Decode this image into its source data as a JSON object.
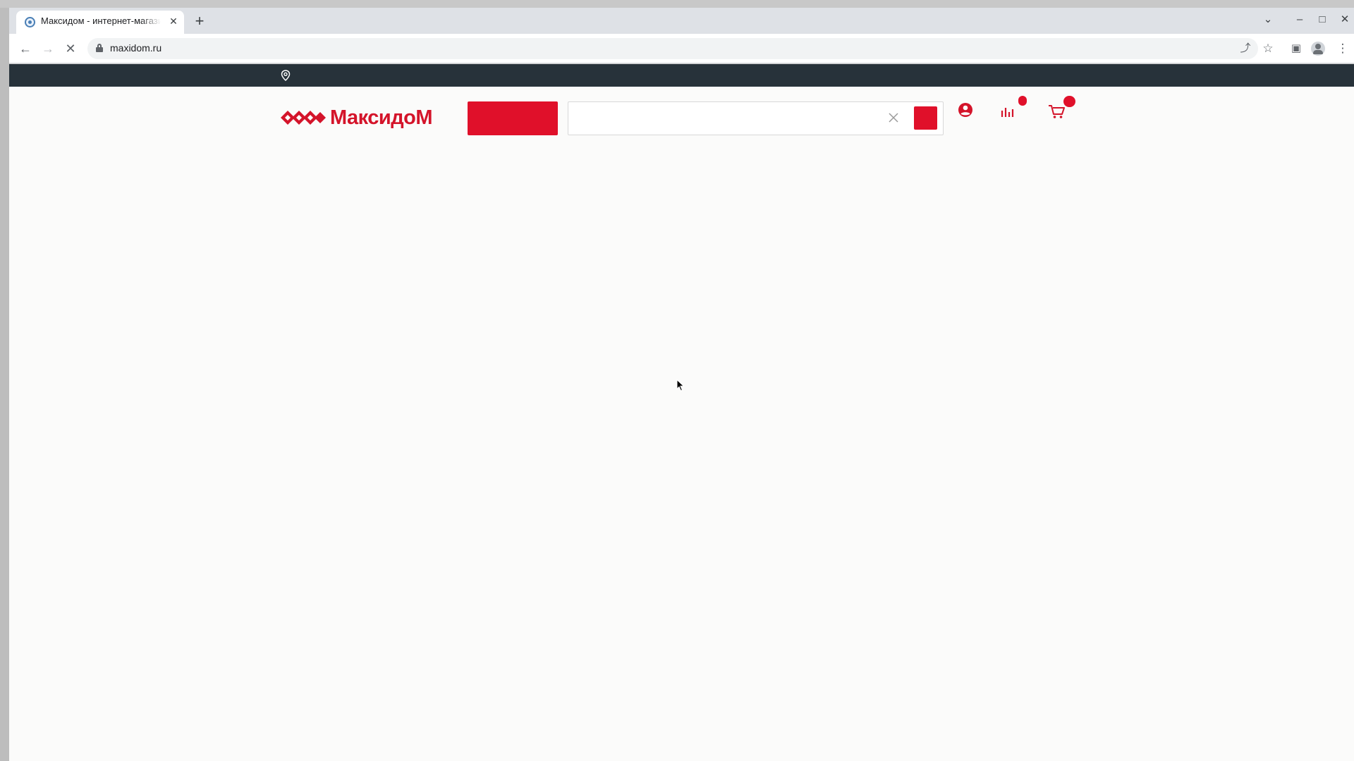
{
  "browser": {
    "tab_title": "Максидом - интернет-магазин",
    "tab_close": "✕",
    "new_tab": "+",
    "url": "maxidom.ru",
    "window_controls": {
      "list": "⌄",
      "minimize": "–",
      "maximize": "□",
      "close": "✕"
    },
    "nav": {
      "back": "←",
      "forward": "→",
      "stop": "✕"
    },
    "toolbar": {
      "share": "⤴",
      "bookmark": "☆",
      "side_panel": "▣",
      "menu": "⋮"
    }
  },
  "site": {
    "logo_text": "МаксидоМ",
    "search": {
      "value": "",
      "placeholder": ""
    },
    "accent_color": "#e0102a",
    "topbar_color": "#27323a"
  },
  "icons": [
    "location-pin-icon",
    "user-account-icon",
    "compare-icon",
    "cart-icon",
    "search-clear-icon"
  ]
}
